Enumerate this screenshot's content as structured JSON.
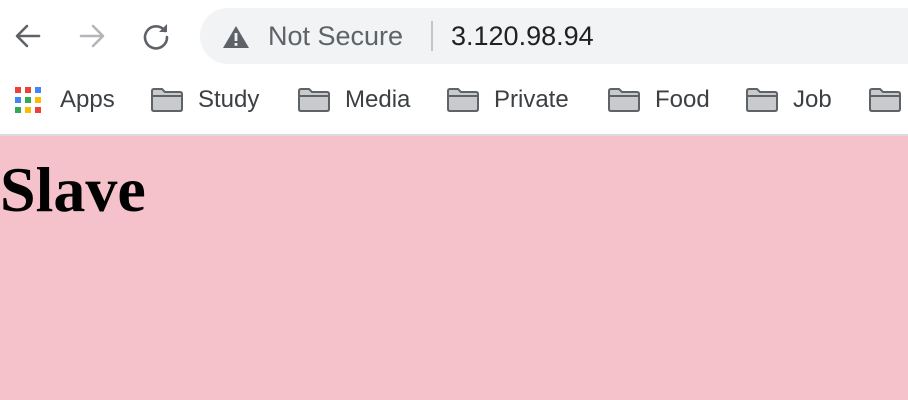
{
  "browser": {
    "nav": {
      "back_icon": "arrow-left-icon",
      "forward_icon": "arrow-right-icon",
      "reload_icon": "reload-icon"
    },
    "omnibox": {
      "security_icon": "warning-triangle-icon",
      "security_label": "Not Secure",
      "url": "3.120.98.94"
    }
  },
  "bookmarks": {
    "apps_label": "Apps",
    "items": [
      {
        "label": "Study",
        "icon": "folder-icon"
      },
      {
        "label": "Media",
        "icon": "folder-icon"
      },
      {
        "label": "Private",
        "icon": "folder-icon"
      },
      {
        "label": "Food",
        "icon": "folder-icon"
      },
      {
        "label": "Job",
        "icon": "folder-icon"
      }
    ]
  },
  "page": {
    "heading": "Slave",
    "background_color": "#f5c1ca"
  }
}
